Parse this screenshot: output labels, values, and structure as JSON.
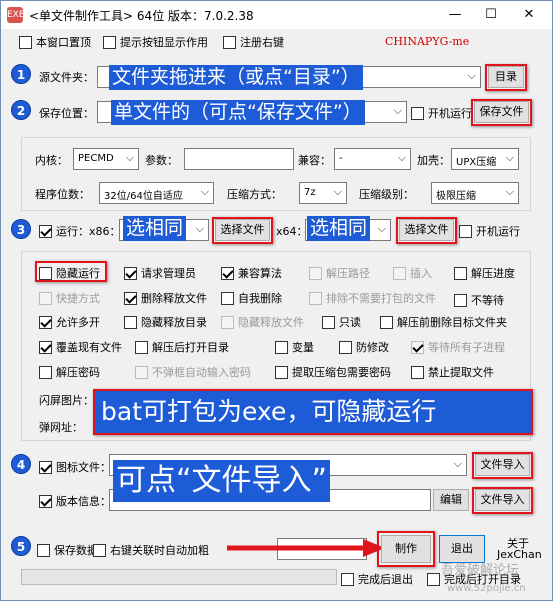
{
  "window": {
    "title": "<单文件制作工具> 64位 版本：7.0.2.38",
    "app_icon": "EXE",
    "min": "—",
    "max": "☐",
    "close": "✕"
  },
  "top_options": {
    "stay_on_top": "本窗口置顶",
    "show_tips": "提示按钮显示作用",
    "register_context": "注册右键"
  },
  "watermark": "CHINAPYG-me",
  "steps": [
    "1",
    "2",
    "3",
    "4",
    "5"
  ],
  "source": {
    "label": "源文件夹：",
    "browse": "目录",
    "overlay": "文件夹拖进来（或点“目录”）"
  },
  "save": {
    "label": "保存位置：",
    "autostart": "开机运行",
    "button": "保存文件",
    "overlay": "单文件的（可点“保存文件”）"
  },
  "settings": {
    "kernel_label": "内核：",
    "kernel_value": "PECMD",
    "params_label": "参数：",
    "params_value": "",
    "compat_label": "兼容：",
    "compat_value": "-",
    "shell_label": "加壳：",
    "shell_value": "UPX压缩",
    "bits_label": "程序位数：",
    "bits_value": "32位/64位自适应",
    "compress_label": "压缩方式：",
    "compress_value": "7z",
    "level_label": "压缩级别：",
    "level_value": "极限压缩"
  },
  "run": {
    "label": "运行：x86：",
    "x86_button": "选择文件",
    "x64_label": "x64：",
    "x64_button": "选择文件",
    "autostart": "开机运行",
    "overlay1": "选相同",
    "overlay2": "选相同"
  },
  "options": {
    "hide_run": "隐藏运行",
    "request_admin": "请求管理员",
    "compat_algo": "兼容算法",
    "unzip_path": "解压路径",
    "insert": "插入",
    "unzip_progress": "解压进度",
    "shortcut": "快捷方式",
    "delete_release": "删除释放文件",
    "self_delete": "自我删除",
    "exclude_files": "排除不需要打包的文件",
    "no_wait": "不等待",
    "allow_multi": "允许多开",
    "hide_release_dir": "隐藏释放目录",
    "hide_release_file": "隐藏释放文件",
    "readonly": "只读",
    "clear_target": "解压前删除目标文件夹",
    "overwrite": "覆盖现有文件",
    "open_dir": "解压后打开目录",
    "variable": "变量",
    "anti_modify": "防修改",
    "wait_children": "等待所有子进程",
    "unzip_pwd": "解压密码",
    "no_auto_pwd": "不弹框自动输入密码",
    "need_pwd": "提取压缩包需要密码",
    "forbid_extract": "禁止提取文件"
  },
  "splash": {
    "label": "闪屏图片：",
    "url_label": "弹网址："
  },
  "bat_overlay": "bat可打包为exe，可隐藏运行",
  "icon": {
    "label": "图标文件：",
    "button": "文件导入",
    "overlay": "可点“文件导入”"
  },
  "version": {
    "label": "版本信息：",
    "edit": "编辑",
    "button": "文件导入"
  },
  "bottom": {
    "save_data": "保存数据",
    "close_after": "右键关联时自动加粗",
    "make": "制作",
    "exit": "退出",
    "about": "关于",
    "author": "JexChan",
    "exit_after": "完成后退出",
    "open_after": "完成后打开目录",
    "watermark": "吾爱破解论坛",
    "watermark2": "www.52pojie.cn"
  }
}
